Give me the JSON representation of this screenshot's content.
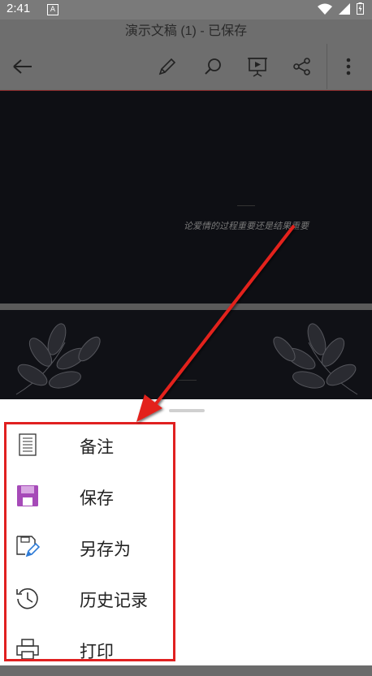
{
  "status": {
    "time": "2:41",
    "notif_badge": "A"
  },
  "document": {
    "title": "演示文稿 (1) - 已保存"
  },
  "toolbar": {
    "icons": [
      "back-arrow-icon",
      "pencil-icon",
      "search-icon",
      "slideshow-icon",
      "share-icon",
      "more-vertical-icon"
    ]
  },
  "slides": {
    "slide1_subtitle": "论爱情的过程重要还是结果重要"
  },
  "menu": {
    "items": [
      {
        "label": "备注",
        "icon": "notes-icon"
      },
      {
        "label": "保存",
        "icon": "save-icon"
      },
      {
        "label": "另存为",
        "icon": "save-as-icon"
      },
      {
        "label": "历史记录",
        "icon": "history-icon"
      },
      {
        "label": "打印",
        "icon": "print-icon"
      }
    ]
  },
  "colors": {
    "highlight": "#e02020",
    "save_icon": "#a64ab8",
    "sheet_bg": "#ffffff",
    "slide_bg": "#0e0f14"
  }
}
